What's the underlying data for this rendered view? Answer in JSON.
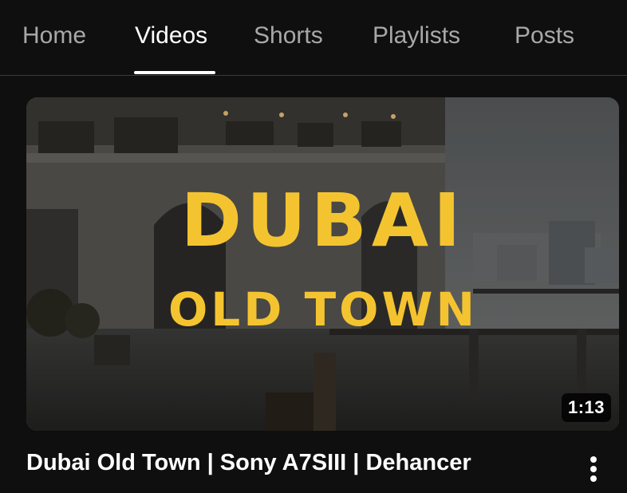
{
  "tabs": [
    {
      "label": "Home",
      "active": false
    },
    {
      "label": "Videos",
      "active": true
    },
    {
      "label": "Shorts",
      "active": false
    },
    {
      "label": "Playlists",
      "active": false
    },
    {
      "label": "Posts",
      "active": false
    }
  ],
  "video": {
    "thumbnail_title_line1": "DUBAI",
    "thumbnail_title_line2": "OLD TOWN",
    "thumbnail_text_color": "#f4c430",
    "duration": "1:13",
    "title": "Dubai Old Town | Sony A7SIII | Dehancer",
    "menu_icon": "more-vertical-icon"
  }
}
